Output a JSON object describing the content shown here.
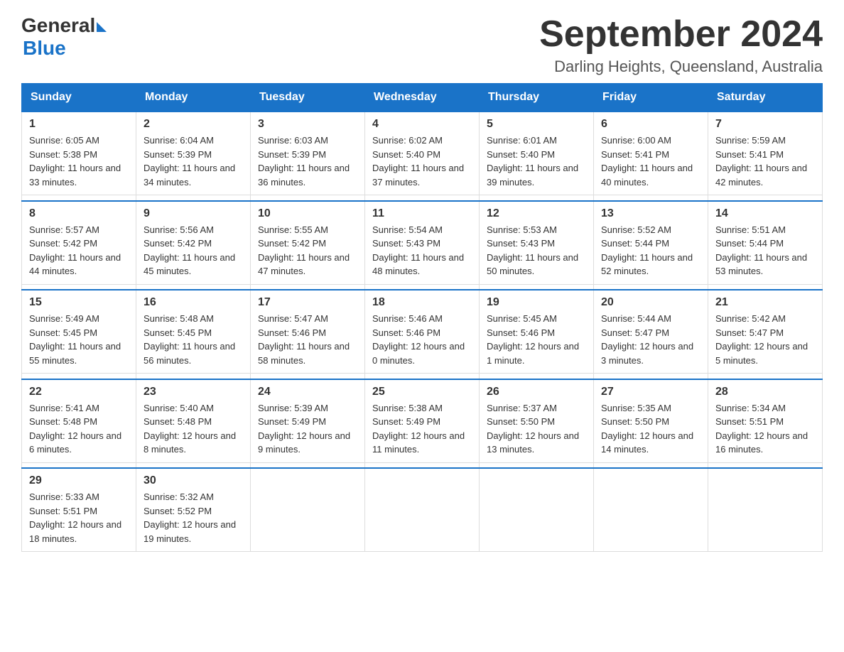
{
  "logo": {
    "general": "General",
    "blue": "Blue"
  },
  "title": "September 2024",
  "subtitle": "Darling Heights, Queensland, Australia",
  "days_of_week": [
    "Sunday",
    "Monday",
    "Tuesday",
    "Wednesday",
    "Thursday",
    "Friday",
    "Saturday"
  ],
  "weeks": [
    [
      {
        "day": "1",
        "sunrise": "6:05 AM",
        "sunset": "5:38 PM",
        "daylight": "11 hours and 33 minutes."
      },
      {
        "day": "2",
        "sunrise": "6:04 AM",
        "sunset": "5:39 PM",
        "daylight": "11 hours and 34 minutes."
      },
      {
        "day": "3",
        "sunrise": "6:03 AM",
        "sunset": "5:39 PM",
        "daylight": "11 hours and 36 minutes."
      },
      {
        "day": "4",
        "sunrise": "6:02 AM",
        "sunset": "5:40 PM",
        "daylight": "11 hours and 37 minutes."
      },
      {
        "day": "5",
        "sunrise": "6:01 AM",
        "sunset": "5:40 PM",
        "daylight": "11 hours and 39 minutes."
      },
      {
        "day": "6",
        "sunrise": "6:00 AM",
        "sunset": "5:41 PM",
        "daylight": "11 hours and 40 minutes."
      },
      {
        "day": "7",
        "sunrise": "5:59 AM",
        "sunset": "5:41 PM",
        "daylight": "11 hours and 42 minutes."
      }
    ],
    [
      {
        "day": "8",
        "sunrise": "5:57 AM",
        "sunset": "5:42 PM",
        "daylight": "11 hours and 44 minutes."
      },
      {
        "day": "9",
        "sunrise": "5:56 AM",
        "sunset": "5:42 PM",
        "daylight": "11 hours and 45 minutes."
      },
      {
        "day": "10",
        "sunrise": "5:55 AM",
        "sunset": "5:42 PM",
        "daylight": "11 hours and 47 minutes."
      },
      {
        "day": "11",
        "sunrise": "5:54 AM",
        "sunset": "5:43 PM",
        "daylight": "11 hours and 48 minutes."
      },
      {
        "day": "12",
        "sunrise": "5:53 AM",
        "sunset": "5:43 PM",
        "daylight": "11 hours and 50 minutes."
      },
      {
        "day": "13",
        "sunrise": "5:52 AM",
        "sunset": "5:44 PM",
        "daylight": "11 hours and 52 minutes."
      },
      {
        "day": "14",
        "sunrise": "5:51 AM",
        "sunset": "5:44 PM",
        "daylight": "11 hours and 53 minutes."
      }
    ],
    [
      {
        "day": "15",
        "sunrise": "5:49 AM",
        "sunset": "5:45 PM",
        "daylight": "11 hours and 55 minutes."
      },
      {
        "day": "16",
        "sunrise": "5:48 AM",
        "sunset": "5:45 PM",
        "daylight": "11 hours and 56 minutes."
      },
      {
        "day": "17",
        "sunrise": "5:47 AM",
        "sunset": "5:46 PM",
        "daylight": "11 hours and 58 minutes."
      },
      {
        "day": "18",
        "sunrise": "5:46 AM",
        "sunset": "5:46 PM",
        "daylight": "12 hours and 0 minutes."
      },
      {
        "day": "19",
        "sunrise": "5:45 AM",
        "sunset": "5:46 PM",
        "daylight": "12 hours and 1 minute."
      },
      {
        "day": "20",
        "sunrise": "5:44 AM",
        "sunset": "5:47 PM",
        "daylight": "12 hours and 3 minutes."
      },
      {
        "day": "21",
        "sunrise": "5:42 AM",
        "sunset": "5:47 PM",
        "daylight": "12 hours and 5 minutes."
      }
    ],
    [
      {
        "day": "22",
        "sunrise": "5:41 AM",
        "sunset": "5:48 PM",
        "daylight": "12 hours and 6 minutes."
      },
      {
        "day": "23",
        "sunrise": "5:40 AM",
        "sunset": "5:48 PM",
        "daylight": "12 hours and 8 minutes."
      },
      {
        "day": "24",
        "sunrise": "5:39 AM",
        "sunset": "5:49 PM",
        "daylight": "12 hours and 9 minutes."
      },
      {
        "day": "25",
        "sunrise": "5:38 AM",
        "sunset": "5:49 PM",
        "daylight": "12 hours and 11 minutes."
      },
      {
        "day": "26",
        "sunrise": "5:37 AM",
        "sunset": "5:50 PM",
        "daylight": "12 hours and 13 minutes."
      },
      {
        "day": "27",
        "sunrise": "5:35 AM",
        "sunset": "5:50 PM",
        "daylight": "12 hours and 14 minutes."
      },
      {
        "day": "28",
        "sunrise": "5:34 AM",
        "sunset": "5:51 PM",
        "daylight": "12 hours and 16 minutes."
      }
    ],
    [
      {
        "day": "29",
        "sunrise": "5:33 AM",
        "sunset": "5:51 PM",
        "daylight": "12 hours and 18 minutes."
      },
      {
        "day": "30",
        "sunrise": "5:32 AM",
        "sunset": "5:52 PM",
        "daylight": "12 hours and 19 minutes."
      },
      null,
      null,
      null,
      null,
      null
    ]
  ],
  "labels": {
    "sunrise": "Sunrise:",
    "sunset": "Sunset:",
    "daylight": "Daylight:"
  }
}
